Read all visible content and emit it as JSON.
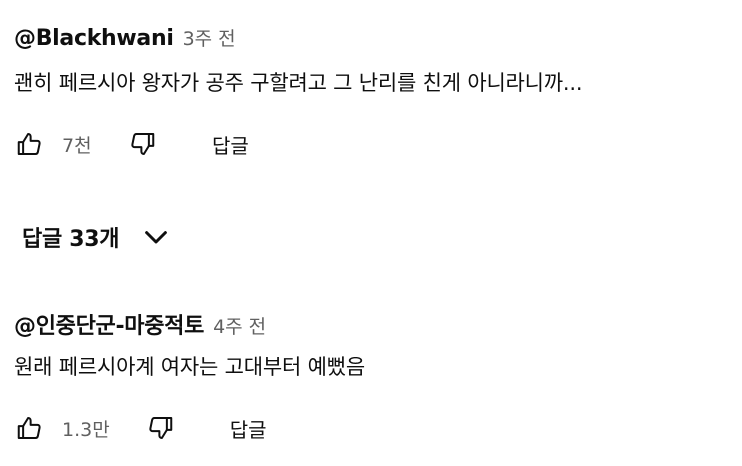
{
  "comments": [
    {
      "author": "@Blackhwani",
      "time": "3주 전",
      "text": "괜히 페르시아 왕자가 공주 구할려고 그 난리를 친게 아니라니까...",
      "likes": "7천",
      "reply_label": "답글"
    },
    {
      "author": "@인중단군-마중적토",
      "time": "4주 전",
      "text": "원래 페르시아계 여자는 고대부터 예뻤음",
      "likes": "1.3만",
      "reply_label": "답글"
    }
  ],
  "replies_toggle": {
    "label": "답글 33개"
  },
  "icons": {
    "like": "thumbs-up-icon",
    "dislike": "thumbs-down-icon",
    "expand": "chevron-down-icon"
  }
}
